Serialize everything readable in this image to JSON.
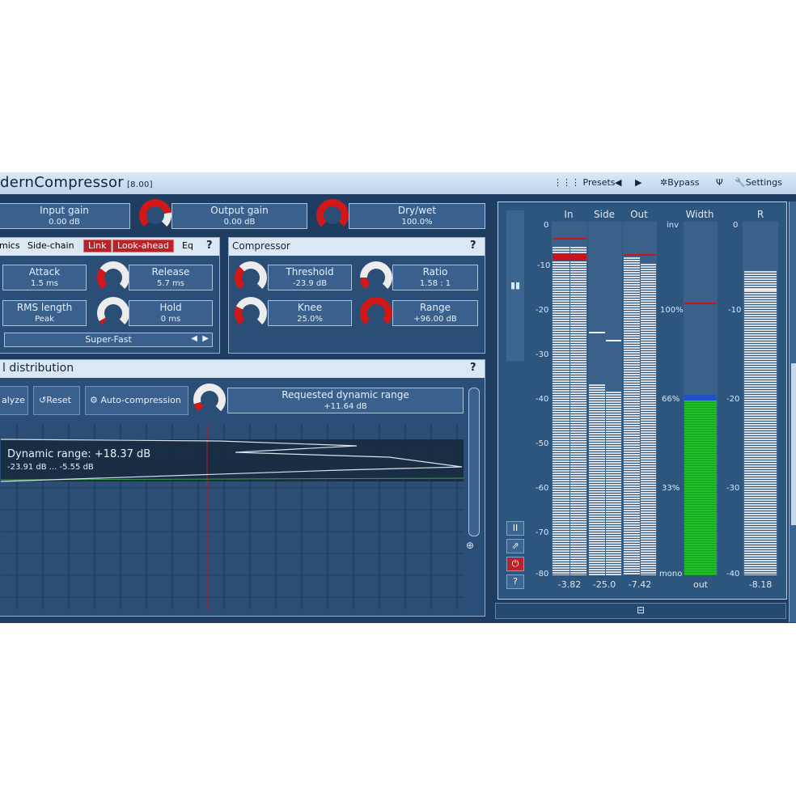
{
  "titlebar": {
    "title": "dernCompressor",
    "version": "[8.00]",
    "presets_label": "Presets",
    "prev_arrow": "◀",
    "next_arrow": "▶",
    "bypass_label": "Bypass",
    "settings_label": "Settings"
  },
  "top_controls": {
    "input_gain": {
      "label": "Input gain",
      "value": "0.00 dB"
    },
    "output_gain": {
      "label": "Output gain",
      "value": "0.00 dB"
    },
    "dry_wet": {
      "label": "Dry/wet",
      "value": "100.0%"
    }
  },
  "dynamics_panel": {
    "tabs": [
      "mics",
      "Side-chain",
      "Link",
      "Look-ahead",
      "Eq"
    ],
    "help": "?",
    "attack": {
      "label": "Attack",
      "value": "1.5 ms"
    },
    "release": {
      "label": "Release",
      "value": "5.7 ms"
    },
    "rms_length": {
      "label": "RMS length",
      "value": "Peak"
    },
    "hold": {
      "label": "Hold",
      "value": "0 ms"
    },
    "preset": {
      "value": "Super-Fast",
      "left": "◀",
      "right": "▶"
    }
  },
  "compressor_panel": {
    "title": "Compressor",
    "help": "?",
    "threshold": {
      "label": "Threshold",
      "value": "-23.9 dB"
    },
    "ratio": {
      "label": "Ratio",
      "value": "1.58 : 1"
    },
    "knee": {
      "label": "Knee",
      "value": "25.0%"
    },
    "range": {
      "label": "Range",
      "value": "+96.00 dB"
    }
  },
  "distribution_panel": {
    "title": "l distribution",
    "help": "?",
    "analyze_label": "alyze",
    "reset_label": "Reset",
    "autocomp_label": "Auto-compression",
    "requested": {
      "label": "Requested dynamic range",
      "value": "+11.64 dB"
    },
    "dynamic_range_text": "Dynamic range: +18.37 dB",
    "range_text": "-23.91 dB ... -5.55 dB"
  },
  "meters": {
    "headers": [
      "In",
      "Side",
      "Out",
      "Width",
      "R"
    ],
    "left_scale": [
      "0",
      "-10",
      "-20",
      "-30",
      "-40",
      "-50",
      "-60",
      "-70",
      "-80"
    ],
    "width_scale": [
      "inv",
      "100%",
      "66%",
      "33%",
      "mono"
    ],
    "right_scale": [
      "0",
      "-10",
      "-20",
      "-30",
      "-40"
    ],
    "bottom_values": [
      "-3.82",
      "-25.0",
      "-7.42",
      "out",
      "-8.18"
    ],
    "levels": {
      "in_l": 0.93,
      "in_r": 0.93,
      "side_l": 0.54,
      "side_r": 0.52,
      "out_l": 0.9,
      "out_r": 0.88,
      "width": 0.5,
      "r": 0.86
    },
    "side_buttons": [
      "II",
      "⇗",
      "⏻",
      "?"
    ],
    "colors": {
      "accent_red": "#c8141d",
      "width_green": "#1fbf2a",
      "width_blue": "#2050c8"
    }
  },
  "bottom_strip_icon": "minimize-icon"
}
